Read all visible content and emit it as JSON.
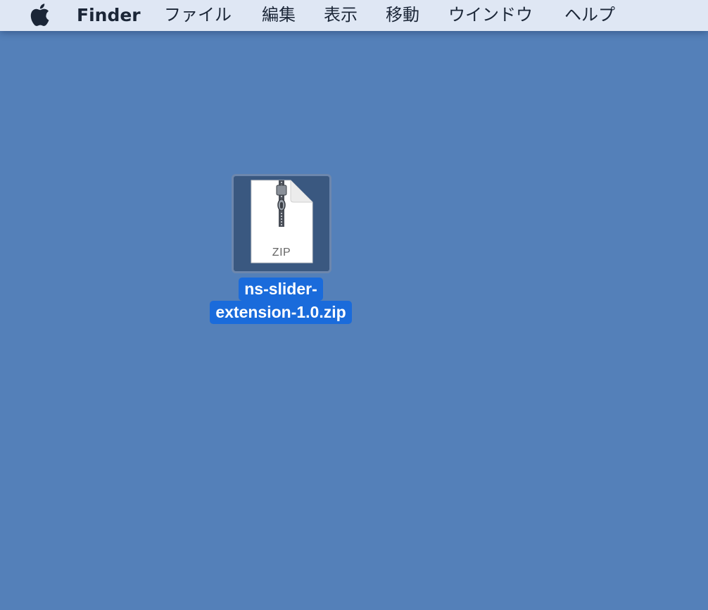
{
  "menubar": {
    "apple_icon": "apple-icon",
    "app_name": "Finder",
    "items": [
      "ファイル",
      "編集",
      "表示",
      "移動",
      "ウインドウ",
      "ヘルプ"
    ]
  },
  "desktop": {
    "background_color": "#5480b9",
    "file": {
      "icon": "zip-archive-icon",
      "type_label": "ZIP",
      "name_line1": "ns-slider-",
      "name_line2": "extension-1.0.zip",
      "selected": true
    }
  },
  "colors": {
    "menubar": "#dfe7f4",
    "selection": "#1a6bdb"
  }
}
